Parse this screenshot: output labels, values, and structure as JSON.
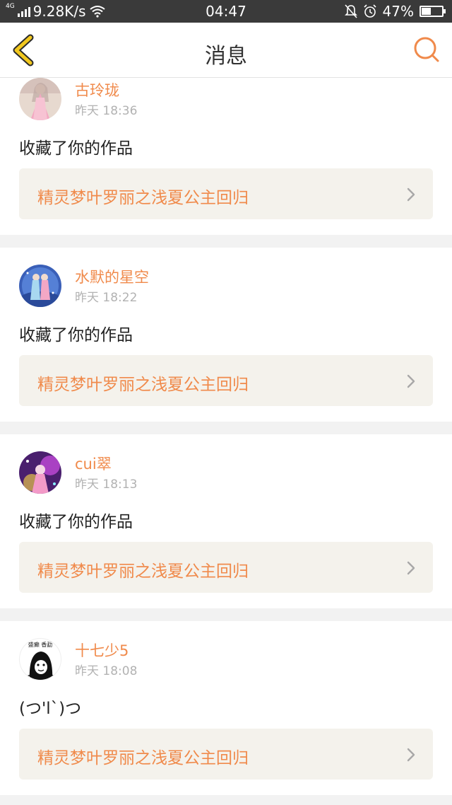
{
  "status_bar": {
    "network": "4G",
    "speed": "9.28K/s",
    "time": "04:47",
    "battery": "47%",
    "battery_level": 0.47
  },
  "header": {
    "title": "消息"
  },
  "colors": {
    "accent": "#f08a4b",
    "back_icon": "#f2c81e",
    "card_link_bg": "#f4f2ec"
  },
  "messages": [
    {
      "name": "古玲珑",
      "time": "昨天 18:36",
      "text": "收藏了你的作品",
      "work_title": "精灵梦叶罗丽之浅夏公主回归"
    },
    {
      "name": "水默的星空",
      "time": "昨天 18:22",
      "text": "收藏了你的作品",
      "work_title": "精灵梦叶罗丽之浅夏公主回归"
    },
    {
      "name": "cui翠",
      "time": "昨天 18:13",
      "text": "收藏了你的作品",
      "work_title": "精灵梦叶罗丽之浅夏公主回归"
    },
    {
      "name": "十七少5",
      "time": "昨天 18:08",
      "text": "(つ'l`)つ",
      "work_title": "精灵梦叶罗丽之浅夏公主回归",
      "avatar_caption": "盛癫 香勐"
    }
  ]
}
